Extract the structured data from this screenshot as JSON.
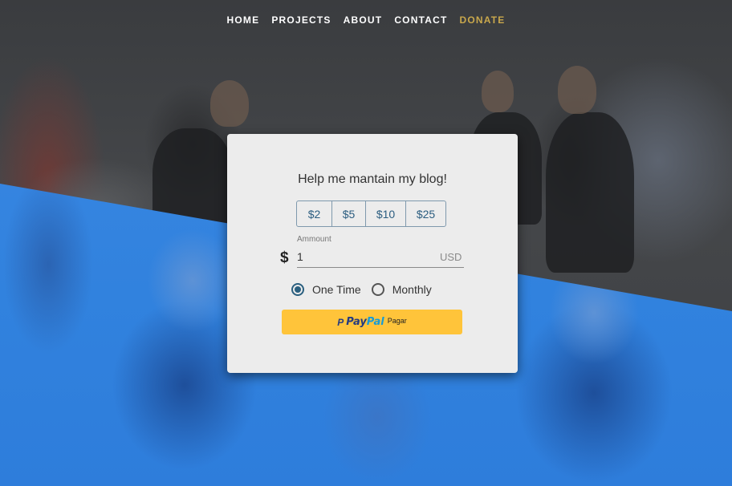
{
  "nav": {
    "items": [
      {
        "label": "HOME"
      },
      {
        "label": "PROJECTS"
      },
      {
        "label": "ABOUT"
      },
      {
        "label": "CONTACT"
      },
      {
        "label": "DONATE",
        "active": true
      }
    ]
  },
  "donate_card": {
    "title": "Help me mantain my blog!",
    "amount_options": [
      "$2",
      "$5",
      "$10",
      "$25"
    ],
    "amount_field": {
      "label": "Ammount",
      "currency_symbol": "$",
      "value": "1",
      "currency": "USD"
    },
    "frequency": {
      "options": [
        {
          "label": "One Time",
          "selected": true
        },
        {
          "label": "Monthly",
          "selected": false
        }
      ]
    },
    "paypal_button": {
      "brand_pay": "Pay",
      "brand_pal": "Pal",
      "label": "Pagar"
    }
  },
  "colors": {
    "accent_donate": "#c9a84c",
    "overlay_blue": "#3182de",
    "paypal_yellow": "#ffc43a",
    "radio_selected": "#2a5f7f"
  }
}
